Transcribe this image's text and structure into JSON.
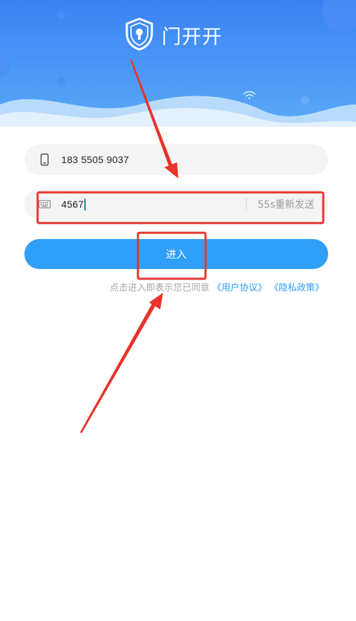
{
  "app": {
    "title": "门开开"
  },
  "phone_field": {
    "icon": "phone-icon",
    "value": "183 5505 9037"
  },
  "code_field": {
    "icon": "keyboard-icon",
    "value": "4567",
    "resend_label": "55s重新发送"
  },
  "enter_button": {
    "label": "进入"
  },
  "agreement": {
    "prefix": "点击进入即表示您已同意",
    "user_agreement": "《用户协议》",
    "privacy_policy": "《隐私政策》"
  },
  "colors": {
    "accent": "#2f9ff8",
    "header_top": "#2b7ff2",
    "annotation": "#e8322b"
  }
}
